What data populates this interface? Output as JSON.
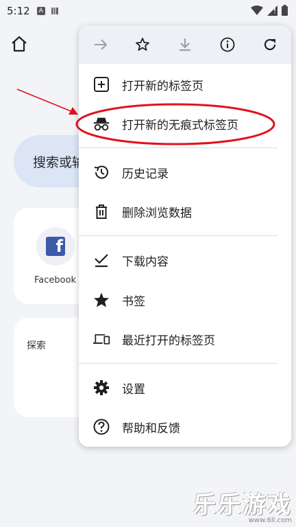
{
  "status_bar": {
    "time": "5:12",
    "app_badge": "A"
  },
  "background": {
    "search_placeholder": "搜索或输入网址",
    "shortcut": {
      "label": "Facebook",
      "logo_letter": "f"
    },
    "explore_label": "探索"
  },
  "menu": {
    "items": [
      {
        "label": "打开新的标签页",
        "icon": "add-box-icon"
      },
      {
        "label": "打开新的无痕式标签页",
        "icon": "incognito-icon"
      },
      {
        "label": "历史记录",
        "icon": "history-icon"
      },
      {
        "label": "删除浏览数据",
        "icon": "trash-icon"
      },
      {
        "label": "下载内容",
        "icon": "download-icon"
      },
      {
        "label": "书签",
        "icon": "star-icon"
      },
      {
        "label": "最近打开的标签页",
        "icon": "devices-icon"
      },
      {
        "label": "设置",
        "icon": "gear-icon"
      },
      {
        "label": "帮助和反馈",
        "icon": "help-icon"
      }
    ]
  },
  "watermark": {
    "text": "乐乐游戏",
    "url": "www.6ll.com"
  },
  "colors": {
    "accent_blue": "#dbe5f6",
    "annotation_red": "#e0121b",
    "menu_toolbar_bg": "#edf0f4",
    "facebook_blue": "#3b5ba9"
  }
}
